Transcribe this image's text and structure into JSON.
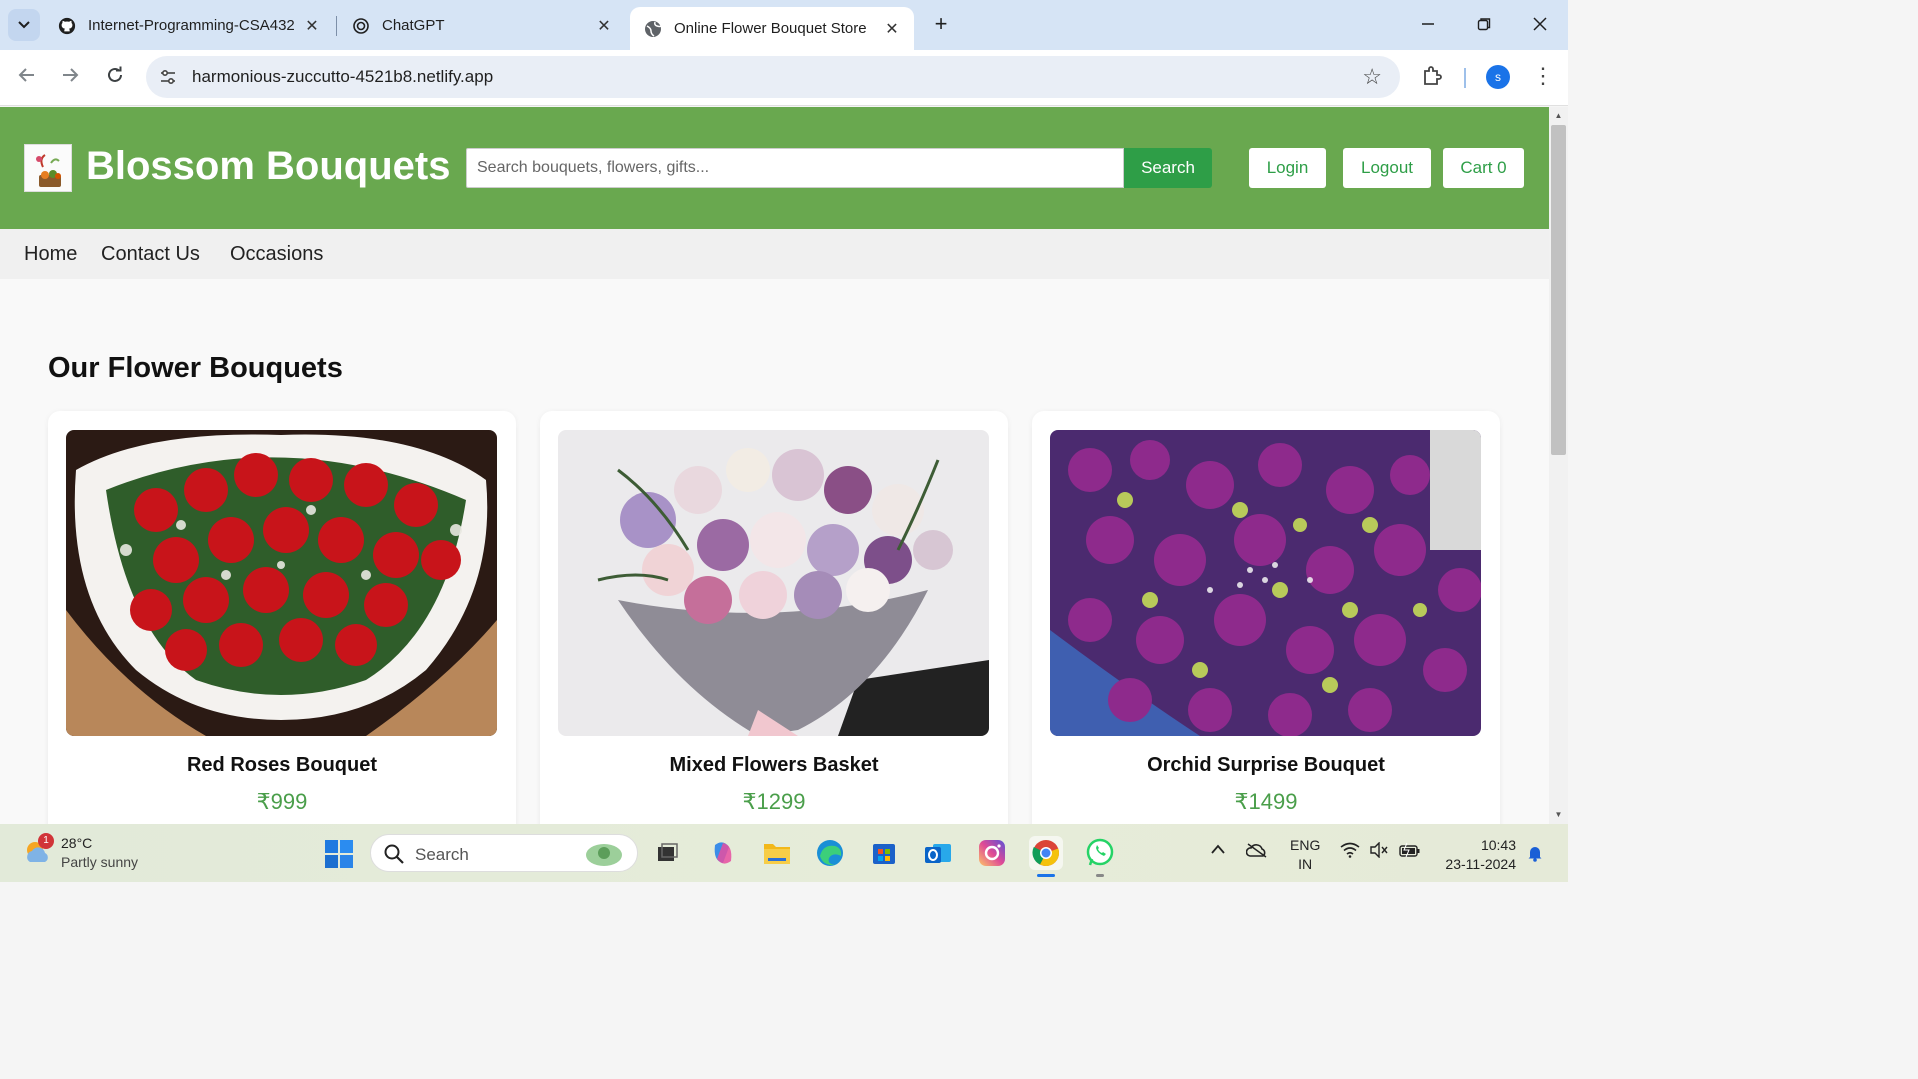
{
  "browser": {
    "tabs": [
      {
        "title": "Internet-Programming-CSA432",
        "icon": "github-icon",
        "active": false
      },
      {
        "title": "ChatGPT",
        "icon": "chatgpt-icon",
        "active": false
      },
      {
        "title": "Online Flower Bouquet Store",
        "icon": "globe-icon",
        "active": true
      }
    ],
    "url": "harmonious-zuccutto-4521b8.netlify.app",
    "profile_initial": "s"
  },
  "site": {
    "brand": "Blossom Bouquets",
    "search_placeholder": "Search bouquets, flowers, gifts...",
    "search_label": "Search",
    "login_label": "Login",
    "logout_label": "Logout",
    "cart_label": "Cart 0",
    "nav": [
      "Home",
      "Contact Us",
      "Occasions"
    ],
    "section_title": "Our Flower Bouquets",
    "products": [
      {
        "name": "Red Roses Bouquet",
        "price": "₹999"
      },
      {
        "name": "Mixed Flowers Basket",
        "price": "₹1299"
      },
      {
        "name": "Orchid Surprise Bouquet",
        "price": "₹1499"
      }
    ],
    "colors": {
      "header": "#69a84f",
      "button": "#2e9e47",
      "price": "#4a9e4a"
    }
  },
  "taskbar": {
    "weather_temp": "28°C",
    "weather_cond": "Partly sunny",
    "weather_badge": "1",
    "search_label": "Search",
    "lang_1": "ENG",
    "lang_2": "IN",
    "time": "10:43",
    "date": "23-11-2024"
  }
}
